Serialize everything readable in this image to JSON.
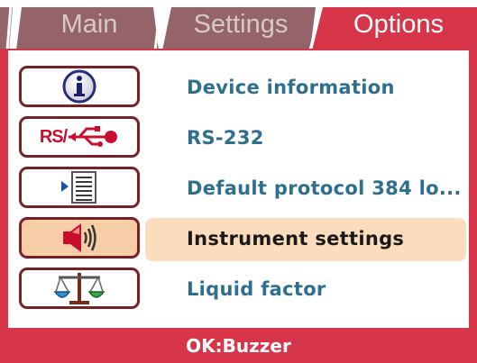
{
  "tabs": [
    {
      "label": "Main",
      "active": false
    },
    {
      "label": "Settings",
      "active": false
    },
    {
      "label": "Options",
      "active": true
    }
  ],
  "menu": {
    "items": [
      {
        "label": "Device information",
        "icon": "info-icon",
        "selected": false
      },
      {
        "label": "RS-232",
        "icon": "rs232-usb-icon",
        "icon_text": "RS/",
        "selected": false
      },
      {
        "label": "Default protocol 384 lo...",
        "icon": "protocol-list-icon",
        "selected": false
      },
      {
        "label": "Instrument settings",
        "icon": "speaker-icon",
        "selected": true
      },
      {
        "label": "Liquid factor",
        "icon": "balance-scale-icon",
        "selected": false
      }
    ]
  },
  "status": {
    "text": "OK:Buzzer"
  },
  "colors": {
    "accent": "#d7354a",
    "tab_inactive": "#95646a",
    "label": "#2e6f8f",
    "selected_bg": "#fbdcbd",
    "icon_border": "#7a1f24"
  }
}
